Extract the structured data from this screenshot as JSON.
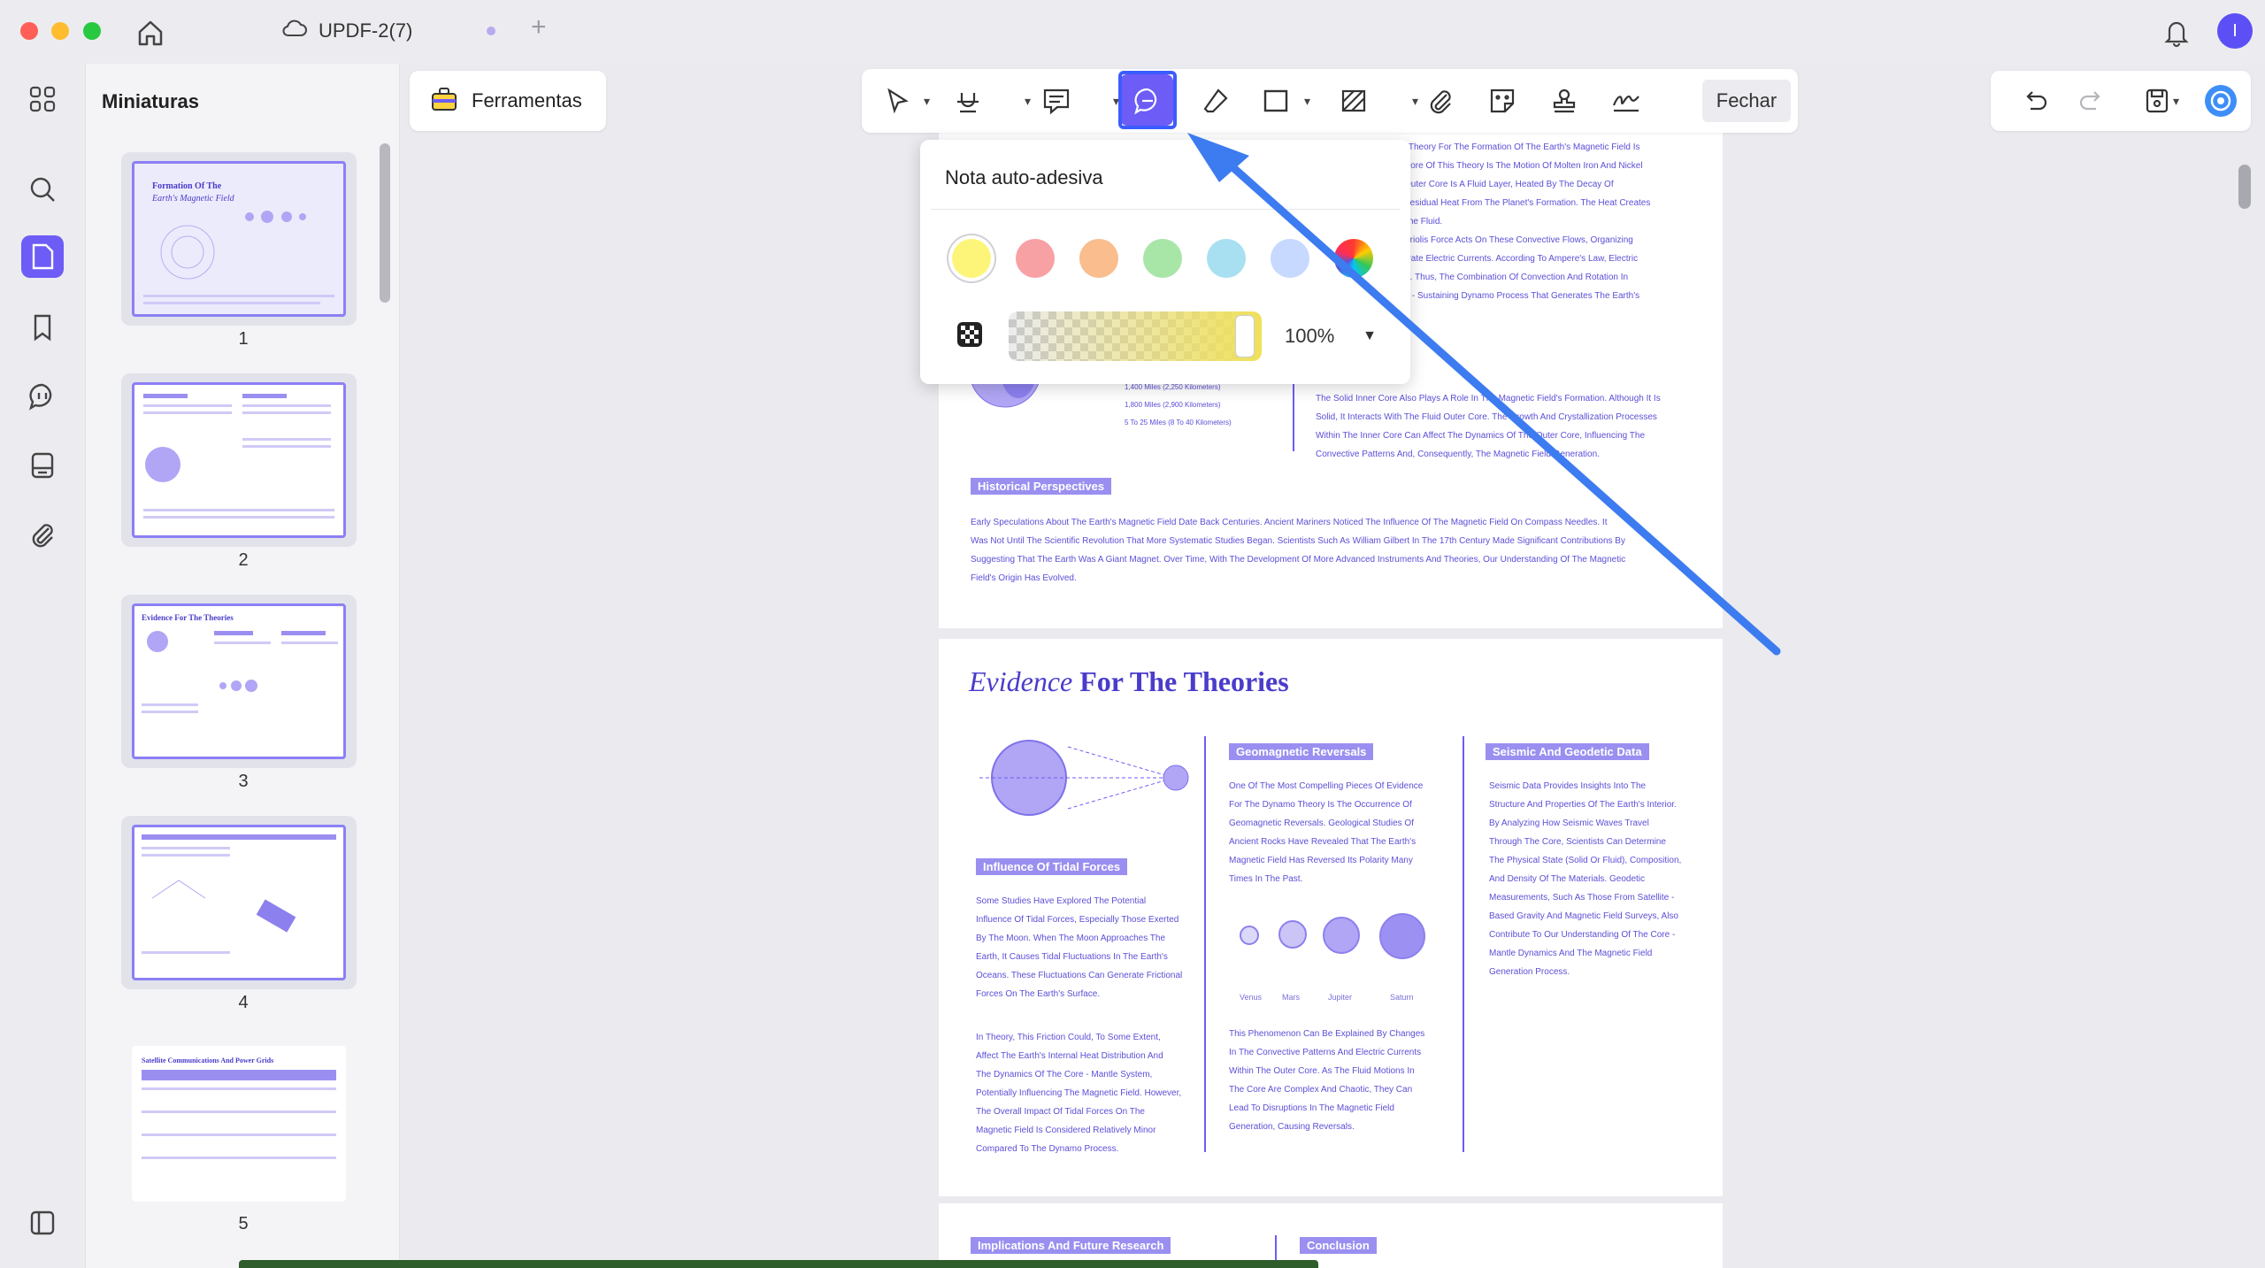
{
  "window": {
    "tab_title": "UPDF-2(7)",
    "avatar_initial": "I"
  },
  "sidebar": {
    "panel_title": "Miniaturas",
    "pages": [
      "1",
      "2",
      "3",
      "4",
      "5"
    ]
  },
  "toolbar": {
    "tools_label": "Ferramentas",
    "close_label": "Fechar"
  },
  "popover": {
    "title": "Nota auto-adesiva",
    "colors": [
      "#fdf579",
      "#f7a1a5",
      "#f9bd8e",
      "#a8e6a8",
      "#a8e0f2",
      "#c7d9ff"
    ],
    "selected_color": "#fdf579",
    "opacity": "100%",
    "opacity_value": 1.0
  },
  "accent_color": "#6d5cf6",
  "document": {
    "page1": {
      "lines_right_top": [
        "...ted Theory For The Formation Of The Earth's Magnetic Field Is",
        "The Core Of This Theory Is The Motion Of Molten Iron And Nickel",
        "The Outer Core Is A Fluid Layer, Heated By The Decay Of",
        "and Residual Heat From The Planet's Formation. The Heat Creates",
        "thin The Fluid.",
        "he Coriolis Force Acts On These Convective Flows, Organizing",
        "Generate Electric Currents. According To Ampere's Law, Electric",
        "Fields. Thus, The Combination Of Convection And Rotation In",
        "A Self - Sustaining Dynamo Process That Generates The Earth's"
      ],
      "inner_core_lines": [
        "The Solid Inner Core Also Plays A Role In The Magnetic Field's Formation. Although It Is",
        "Solid, It Interacts With The Fluid Outer Core. The Growth And Crystallization Processes",
        "Within The Inner Core Can Affect The Dynamics Of The Outer Core, Influencing The",
        "Convective Patterns And, Consequently, The Magnetic Field Generation."
      ],
      "diagram_labels": [
        "1,400 Miles (2,250 Kilometers)",
        "1,800 Miles (2,900 Kilometers)",
        "5 To 25 Miles (8 To 40 Kilometers)"
      ],
      "historical_tag": "Historical Perspectives",
      "historical_lines": [
        "Early Speculations About The Earth's Magnetic Field Date Back Centuries. Ancient Mariners Noticed The Influence Of The Magnetic Field On Compass Needles. It",
        "Was Not Until The Scientific Revolution That More Systematic Studies Began. Scientists Such As William Gilbert In The 17th Century Made Significant Contributions By",
        "Suggesting That The Earth Was A Giant Magnet. Over Time, With The Development Of More Advanced Instruments And Theories, Our Understanding Of The Magnetic",
        "Field's Origin Has Evolved."
      ]
    },
    "page2": {
      "heading_italic": "Evidence",
      "heading_rest": " For The Theories",
      "geomagnetic_tag": "Geomagnetic Reversals",
      "geomagnetic_lines": [
        "One Of The Most Compelling Pieces Of Evidence",
        "For The Dynamo Theory Is The Occurrence Of",
        "Geomagnetic Reversals. Geological Studies Of",
        "Ancient Rocks Have Revealed That The Earth's",
        "Magnetic Field Has Reversed Its Polarity Many",
        "Times In The Past."
      ],
      "planets": [
        "Venus",
        "Mars",
        "Jupiter",
        "Saturn"
      ],
      "phenomenon_lines": [
        "This Phenomenon Can Be Explained By Changes",
        "In The Convective Patterns And Electric Currents",
        "Within The Outer Core. As The Fluid Motions In",
        "The Core Are Complex And Chaotic, They Can",
        "Lead To Disruptions In The Magnetic Field",
        "Generation, Causing Reversals."
      ],
      "seismic_tag": "Seismic And Geodetic Data",
      "seismic_lines": [
        "Seismic Data Provides Insights Into The",
        "Structure And Properties Of The Earth's Interior.",
        "By Analyzing How Seismic Waves Travel",
        "Through The Core, Scientists Can Determine",
        "The Physical State (Solid Or Fluid), Composition,",
        "And Density Of The Materials. Geodetic",
        "Measurements, Such As Those From Satellite -",
        "Based Gravity And Magnetic Field Surveys, Also",
        "Contribute To Our Understanding Of The Core -",
        "Mantle Dynamics And The Magnetic Field",
        "Generation Process."
      ],
      "tidal_tag": "Influence Of Tidal Forces",
      "tidal_lines": [
        "Some Studies Have Explored The Potential",
        "Influence Of Tidal Forces, Especially Those Exerted",
        "By The Moon. When The Moon Approaches The",
        "Earth, It Causes Tidal Fluctuations In The Earth's",
        "Oceans. These Fluctuations Can Generate Frictional",
        "Forces On The Earth's Surface."
      ],
      "friction_lines": [
        "In Theory, This Friction Could, To Some Extent,",
        "Affect The Earth's Internal Heat Distribution And",
        "The Dynamics Of The Core - Mantle System,",
        "Potentially Influencing The Magnetic Field. However,",
        "The Overall Impact Of Tidal Forces On The",
        "Magnetic Field Is Considered Relatively Minor",
        "Compared To The Dynamo Process."
      ]
    },
    "page3": {
      "left_tag": "Implications And Future Research",
      "right_tag": "Conclusion"
    }
  }
}
